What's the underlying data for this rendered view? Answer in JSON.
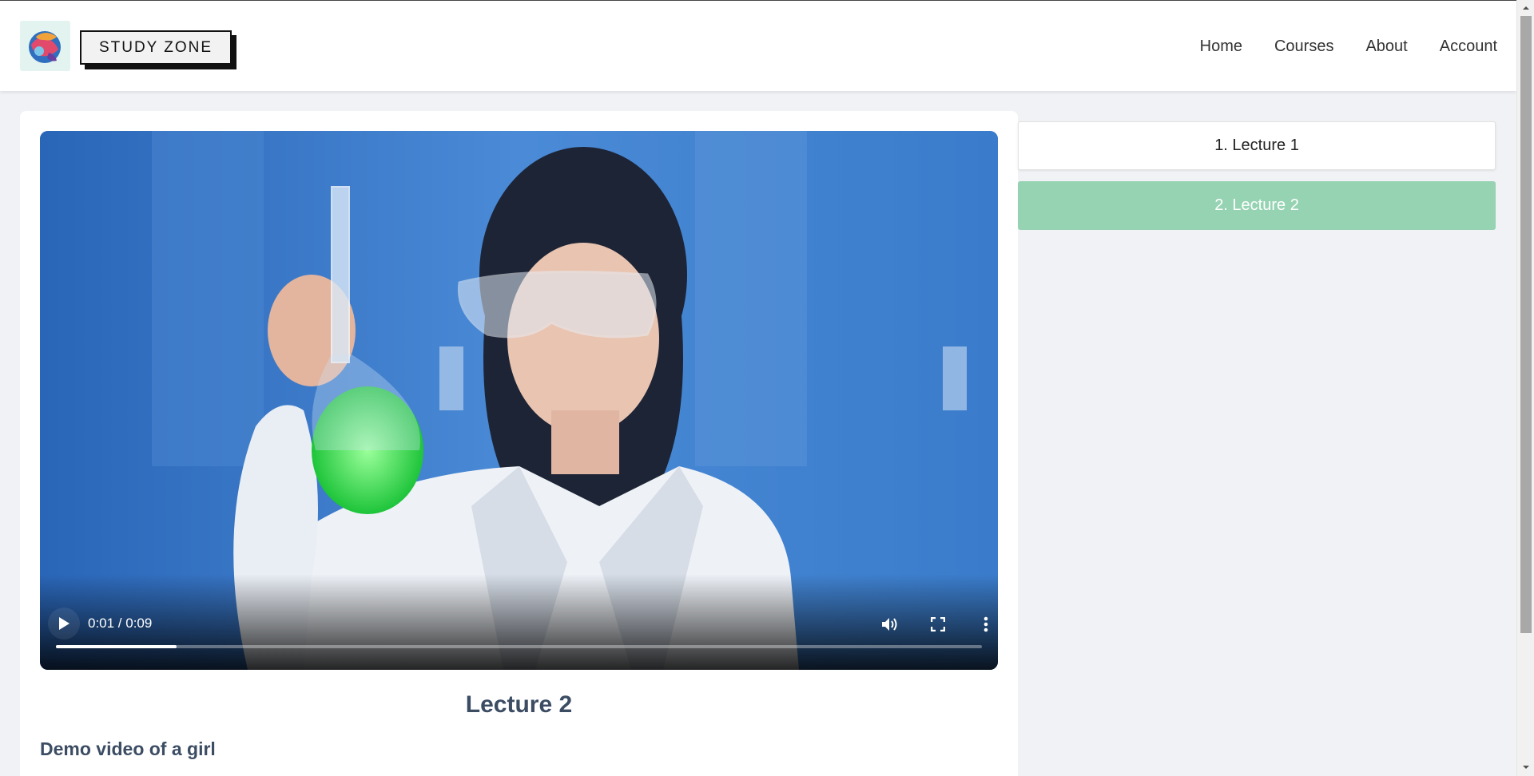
{
  "header": {
    "brand": "STUDY ZONE",
    "nav": [
      "Home",
      "Courses",
      "About",
      "Account"
    ]
  },
  "player": {
    "time": "0:01 / 0:09",
    "progress_fraction": 0.13
  },
  "lecture": {
    "title": "Lecture 2",
    "description": "Demo video of a girl"
  },
  "sidebar": {
    "items": [
      {
        "label": "1. Lecture 1",
        "active": false
      },
      {
        "label": "2. Lecture 2",
        "active": true
      }
    ]
  },
  "colors": {
    "active_lecture": "#95d3b2",
    "heading": "#3b4c63",
    "page_bg": "#f0f2f5"
  }
}
